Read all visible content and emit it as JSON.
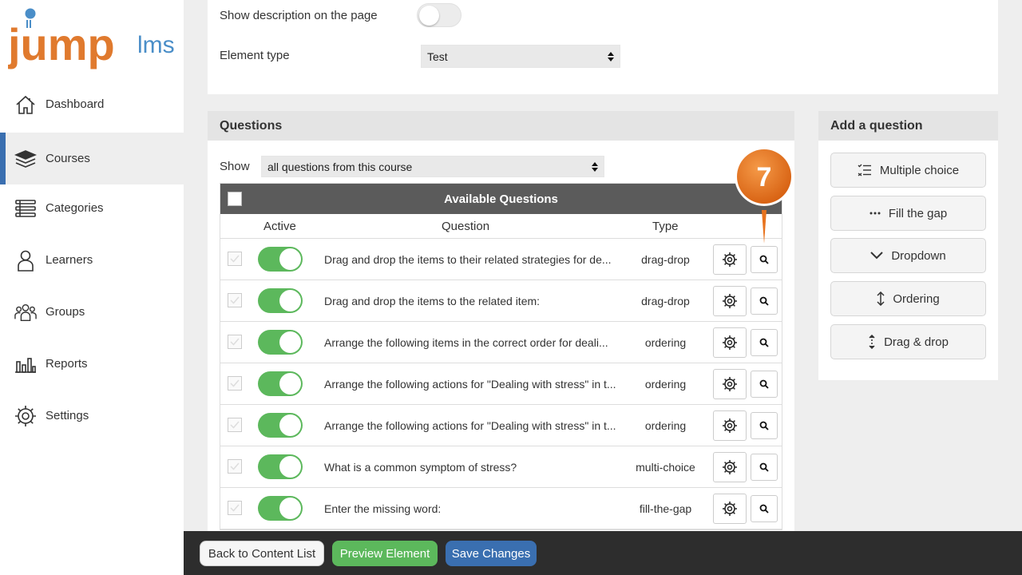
{
  "logo": {
    "brand": "jump",
    "suffix": "lms",
    "primary_color": "#e07a2e",
    "accent_color": "#4a8ec8"
  },
  "sidebar": {
    "items": [
      {
        "label": "Dashboard",
        "icon": "home-icon"
      },
      {
        "label": "Courses",
        "icon": "books-icon",
        "active": true
      },
      {
        "label": "Categories",
        "icon": "list-icon"
      },
      {
        "label": "Learners",
        "icon": "user-icon"
      },
      {
        "label": "Groups",
        "icon": "group-icon"
      },
      {
        "label": "Reports",
        "icon": "bar-chart-icon"
      },
      {
        "label": "Settings",
        "icon": "gear-icon"
      }
    ]
  },
  "form": {
    "show_description_label": "Show description on the page",
    "show_description_on": false,
    "element_type_label": "Element type",
    "element_type_value": "Test"
  },
  "questions": {
    "title": "Questions",
    "show_label": "Show",
    "show_value": "all questions from this course",
    "table_title": "Available Questions",
    "columns": {
      "active": "Active",
      "question": "Question",
      "type": "Type"
    },
    "rows": [
      {
        "question": "Drag and drop the items to their related strategies for de...",
        "type": "drag-drop",
        "active": true
      },
      {
        "question": "Drag and drop the items to the related item:",
        "type": "drag-drop",
        "active": true
      },
      {
        "question": "Arrange the following items in the correct order for deali...",
        "type": "ordering",
        "active": true
      },
      {
        "question": "Arrange the following actions for \"Dealing with stress\" in t...",
        "type": "ordering",
        "active": true
      },
      {
        "question": "Arrange the following actions for \"Dealing with stress\" in t...",
        "type": "ordering",
        "active": true
      },
      {
        "question": "What is a common symptom of stress?",
        "type": "multi-choice",
        "active": true
      },
      {
        "question": "Enter the missing word:",
        "type": "fill-the-gap",
        "active": true
      }
    ]
  },
  "add_question": {
    "title": "Add a question",
    "buttons": [
      {
        "label": "Multiple choice",
        "icon": "checklist-icon"
      },
      {
        "label": "Fill the gap",
        "icon": "ellipsis-icon"
      },
      {
        "label": "Dropdown",
        "icon": "chevron-down-icon"
      },
      {
        "label": "Ordering",
        "icon": "vertical-arrows-icon"
      },
      {
        "label": "Drag & drop",
        "icon": "drag-arrows-icon"
      }
    ]
  },
  "callout": {
    "step": "7",
    "color": "#e8731e"
  },
  "footer": {
    "back_label": "Back to Content List",
    "preview_label": "Preview Element",
    "save_label": "Save Changes"
  }
}
